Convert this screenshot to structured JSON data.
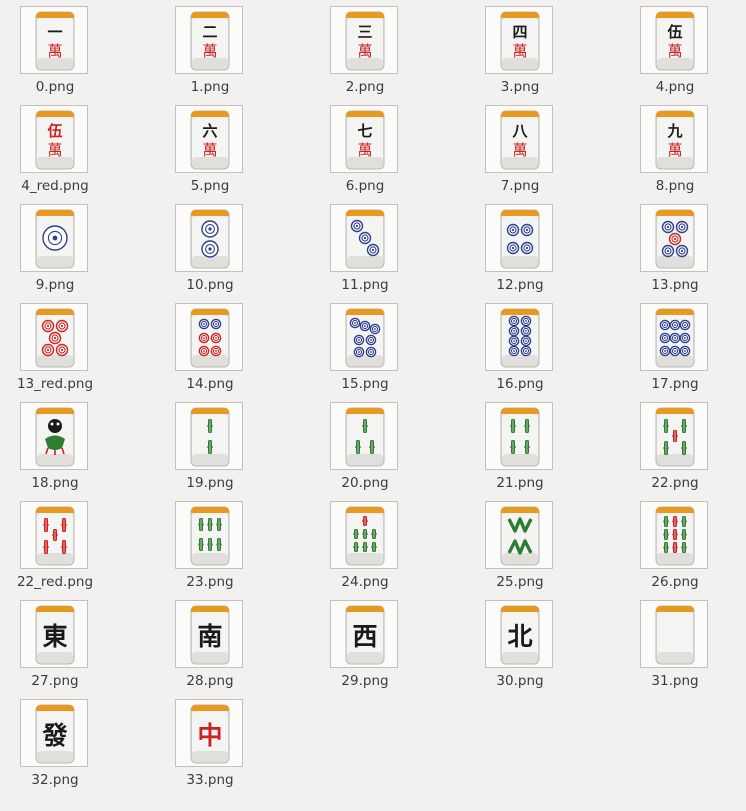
{
  "window": {
    "view": "icon-grid"
  },
  "colors": {
    "background": "#f2f1f0",
    "tile_face": "#e7e6e3",
    "tile_top": "#e79a1f",
    "tile_border": "#b9b7b3",
    "red": "#cc2222",
    "black": "#1a1a1a",
    "blue": "#2f3f8f",
    "green": "#2e7d32"
  },
  "files": [
    {
      "name": "0.png",
      "kind": "man",
      "top": "一",
      "bottom": "萬",
      "topColor": "black"
    },
    {
      "name": "1.png",
      "kind": "man",
      "top": "二",
      "bottom": "萬",
      "topColor": "black"
    },
    {
      "name": "2.png",
      "kind": "man",
      "top": "三",
      "bottom": "萬",
      "topColor": "black"
    },
    {
      "name": "3.png",
      "kind": "man",
      "top": "四",
      "bottom": "萬",
      "topColor": "black"
    },
    {
      "name": "4.png",
      "kind": "man",
      "top": "伍",
      "bottom": "萬",
      "topColor": "black"
    },
    {
      "name": "4_red.png",
      "kind": "man",
      "top": "伍",
      "bottom": "萬",
      "topColor": "red"
    },
    {
      "name": "5.png",
      "kind": "man",
      "top": "六",
      "bottom": "萬",
      "topColor": "black"
    },
    {
      "name": "6.png",
      "kind": "man",
      "top": "七",
      "bottom": "萬",
      "topColor": "black"
    },
    {
      "name": "7.png",
      "kind": "man",
      "top": "八",
      "bottom": "萬",
      "topColor": "black"
    },
    {
      "name": "8.png",
      "kind": "man",
      "top": "九",
      "bottom": "萬",
      "topColor": "black"
    },
    {
      "name": "9.png",
      "kind": "pin",
      "count": 1,
      "red": false
    },
    {
      "name": "10.png",
      "kind": "pin",
      "count": 2,
      "red": false
    },
    {
      "name": "11.png",
      "kind": "pin",
      "count": 3,
      "red": false
    },
    {
      "name": "12.png",
      "kind": "pin",
      "count": 4,
      "red": false
    },
    {
      "name": "13.png",
      "kind": "pin",
      "count": 5,
      "red": false
    },
    {
      "name": "13_red.png",
      "kind": "pin",
      "count": 5,
      "red": true
    },
    {
      "name": "14.png",
      "kind": "pin",
      "count": 6,
      "red": false
    },
    {
      "name": "15.png",
      "kind": "pin",
      "count": 7,
      "red": false
    },
    {
      "name": "16.png",
      "kind": "pin",
      "count": 8,
      "red": false
    },
    {
      "name": "17.png",
      "kind": "pin",
      "count": 9,
      "red": false
    },
    {
      "name": "18.png",
      "kind": "sou",
      "count": 1,
      "red": false
    },
    {
      "name": "19.png",
      "kind": "sou",
      "count": 2,
      "red": false
    },
    {
      "name": "20.png",
      "kind": "sou",
      "count": 3,
      "red": false
    },
    {
      "name": "21.png",
      "kind": "sou",
      "count": 4,
      "red": false
    },
    {
      "name": "22.png",
      "kind": "sou",
      "count": 5,
      "red": false
    },
    {
      "name": "22_red.png",
      "kind": "sou",
      "count": 5,
      "red": true
    },
    {
      "name": "23.png",
      "kind": "sou",
      "count": 6,
      "red": false
    },
    {
      "name": "24.png",
      "kind": "sou",
      "count": 7,
      "red": false
    },
    {
      "name": "25.png",
      "kind": "sou",
      "count": 8,
      "red": false
    },
    {
      "name": "26.png",
      "kind": "sou",
      "count": 9,
      "red": false
    },
    {
      "name": "27.png",
      "kind": "honor",
      "glyph": "東",
      "glyphColor": "black"
    },
    {
      "name": "28.png",
      "kind": "honor",
      "glyph": "南",
      "glyphColor": "black"
    },
    {
      "name": "29.png",
      "kind": "honor",
      "glyph": "西",
      "glyphColor": "black"
    },
    {
      "name": "30.png",
      "kind": "honor",
      "glyph": "北",
      "glyphColor": "black"
    },
    {
      "name": "31.png",
      "kind": "blank"
    },
    {
      "name": "32.png",
      "kind": "honor",
      "glyph": "發",
      "glyphColor": "black"
    },
    {
      "name": "33.png",
      "kind": "honor",
      "glyph": "中",
      "glyphColor": "red"
    }
  ]
}
